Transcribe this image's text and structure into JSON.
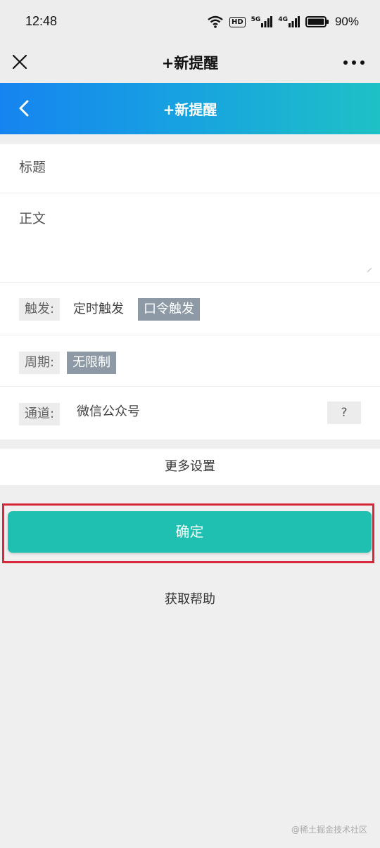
{
  "status_bar": {
    "time": "12:48",
    "hd": "HD",
    "net1": "5G",
    "net2": "4G",
    "battery": "90%"
  },
  "navbar": {
    "title": "+新提醒",
    "close_icon": "close-icon",
    "more_icon": "more-icon"
  },
  "header": {
    "title": "+新提醒",
    "back_icon": "chevron-left-icon"
  },
  "form": {
    "title_placeholder": "标题",
    "body_placeholder": "正文",
    "trigger": {
      "label": "触发:",
      "options": [
        "定时触发",
        "口令触发"
      ],
      "selected": "口令触发"
    },
    "cycle": {
      "label": "周期:",
      "value": "无限制"
    },
    "channel": {
      "label": "通道:",
      "value": "微信公众号",
      "help": "?"
    }
  },
  "more_settings": "更多设置",
  "confirm": "确定",
  "get_help": "获取帮助",
  "watermark": "@稀土掘金技术社区",
  "colors": {
    "header_gradient_start": "#1684f0",
    "header_gradient_end": "#1ec1c6",
    "confirm": "#1fbfb1",
    "highlight_border": "#d9283c",
    "active_option": "#8d9aa5"
  }
}
